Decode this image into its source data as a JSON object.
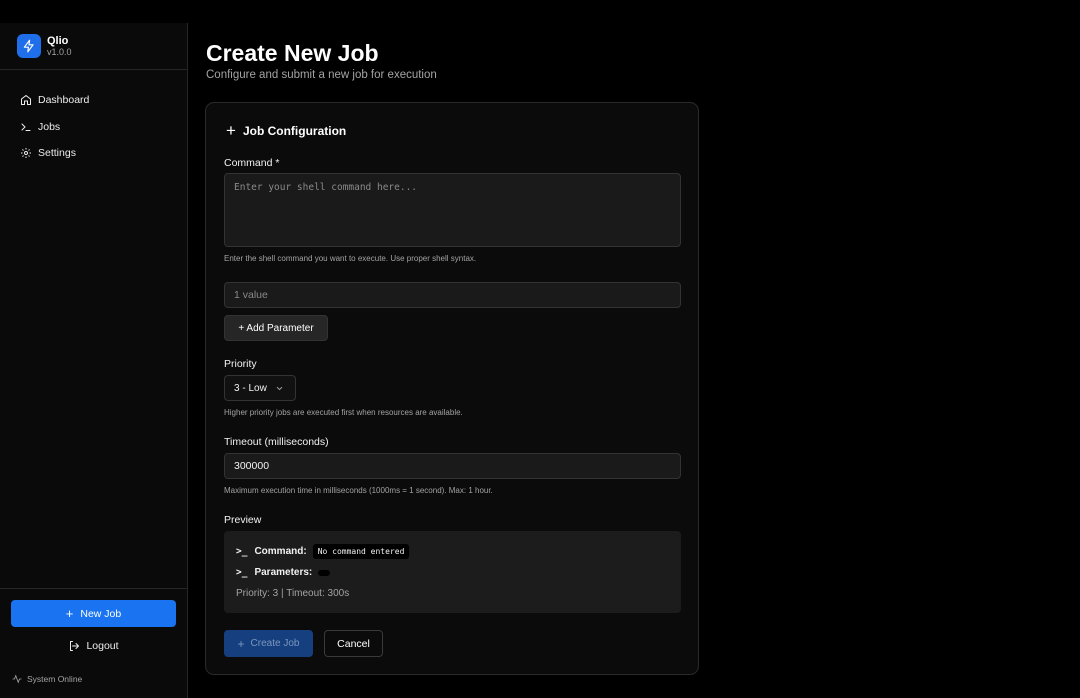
{
  "brand": {
    "name": "Qlio",
    "version": "v1.0.0",
    "logo_icon": "lightning-icon",
    "accent": "#1a73f0"
  },
  "sidebar": {
    "items": [
      {
        "label": "Dashboard",
        "icon": "home-icon"
      },
      {
        "label": "Jobs",
        "icon": "terminal-icon"
      },
      {
        "label": "Settings",
        "icon": "gear-icon"
      }
    ],
    "new_job_label": "New Job",
    "logout_label": "Logout",
    "status_text": "System Online"
  },
  "page": {
    "title": "Create New Job",
    "subtitle": "Configure and submit a new job for execution"
  },
  "form": {
    "card_title": "Job Configuration",
    "command": {
      "label": "Command *",
      "placeholder": "Enter your shell command here...",
      "value": "",
      "help": "Enter the shell command you want to execute. Use proper shell syntax."
    },
    "parameter": {
      "placeholder": "1 value",
      "value": ""
    },
    "add_parameter_label": "+ Add Parameter",
    "priority": {
      "label": "Priority",
      "selected": "3 - Low",
      "help": "Higher priority jobs are executed first when resources are available."
    },
    "timeout": {
      "label": "Timeout (milliseconds)",
      "value": "300000",
      "help": "Maximum execution time in milliseconds (1000ms = 1 second). Max: 1 hour."
    },
    "preview": {
      "label": "Preview",
      "command_key": "Command:",
      "command_value": "No command entered",
      "parameters_key": "Parameters:",
      "parameters_value": "",
      "prompt_glyph": ">_",
      "meta": "Priority: 3 | Timeout: 300s"
    },
    "create_label": "Create Job",
    "cancel_label": "Cancel"
  }
}
